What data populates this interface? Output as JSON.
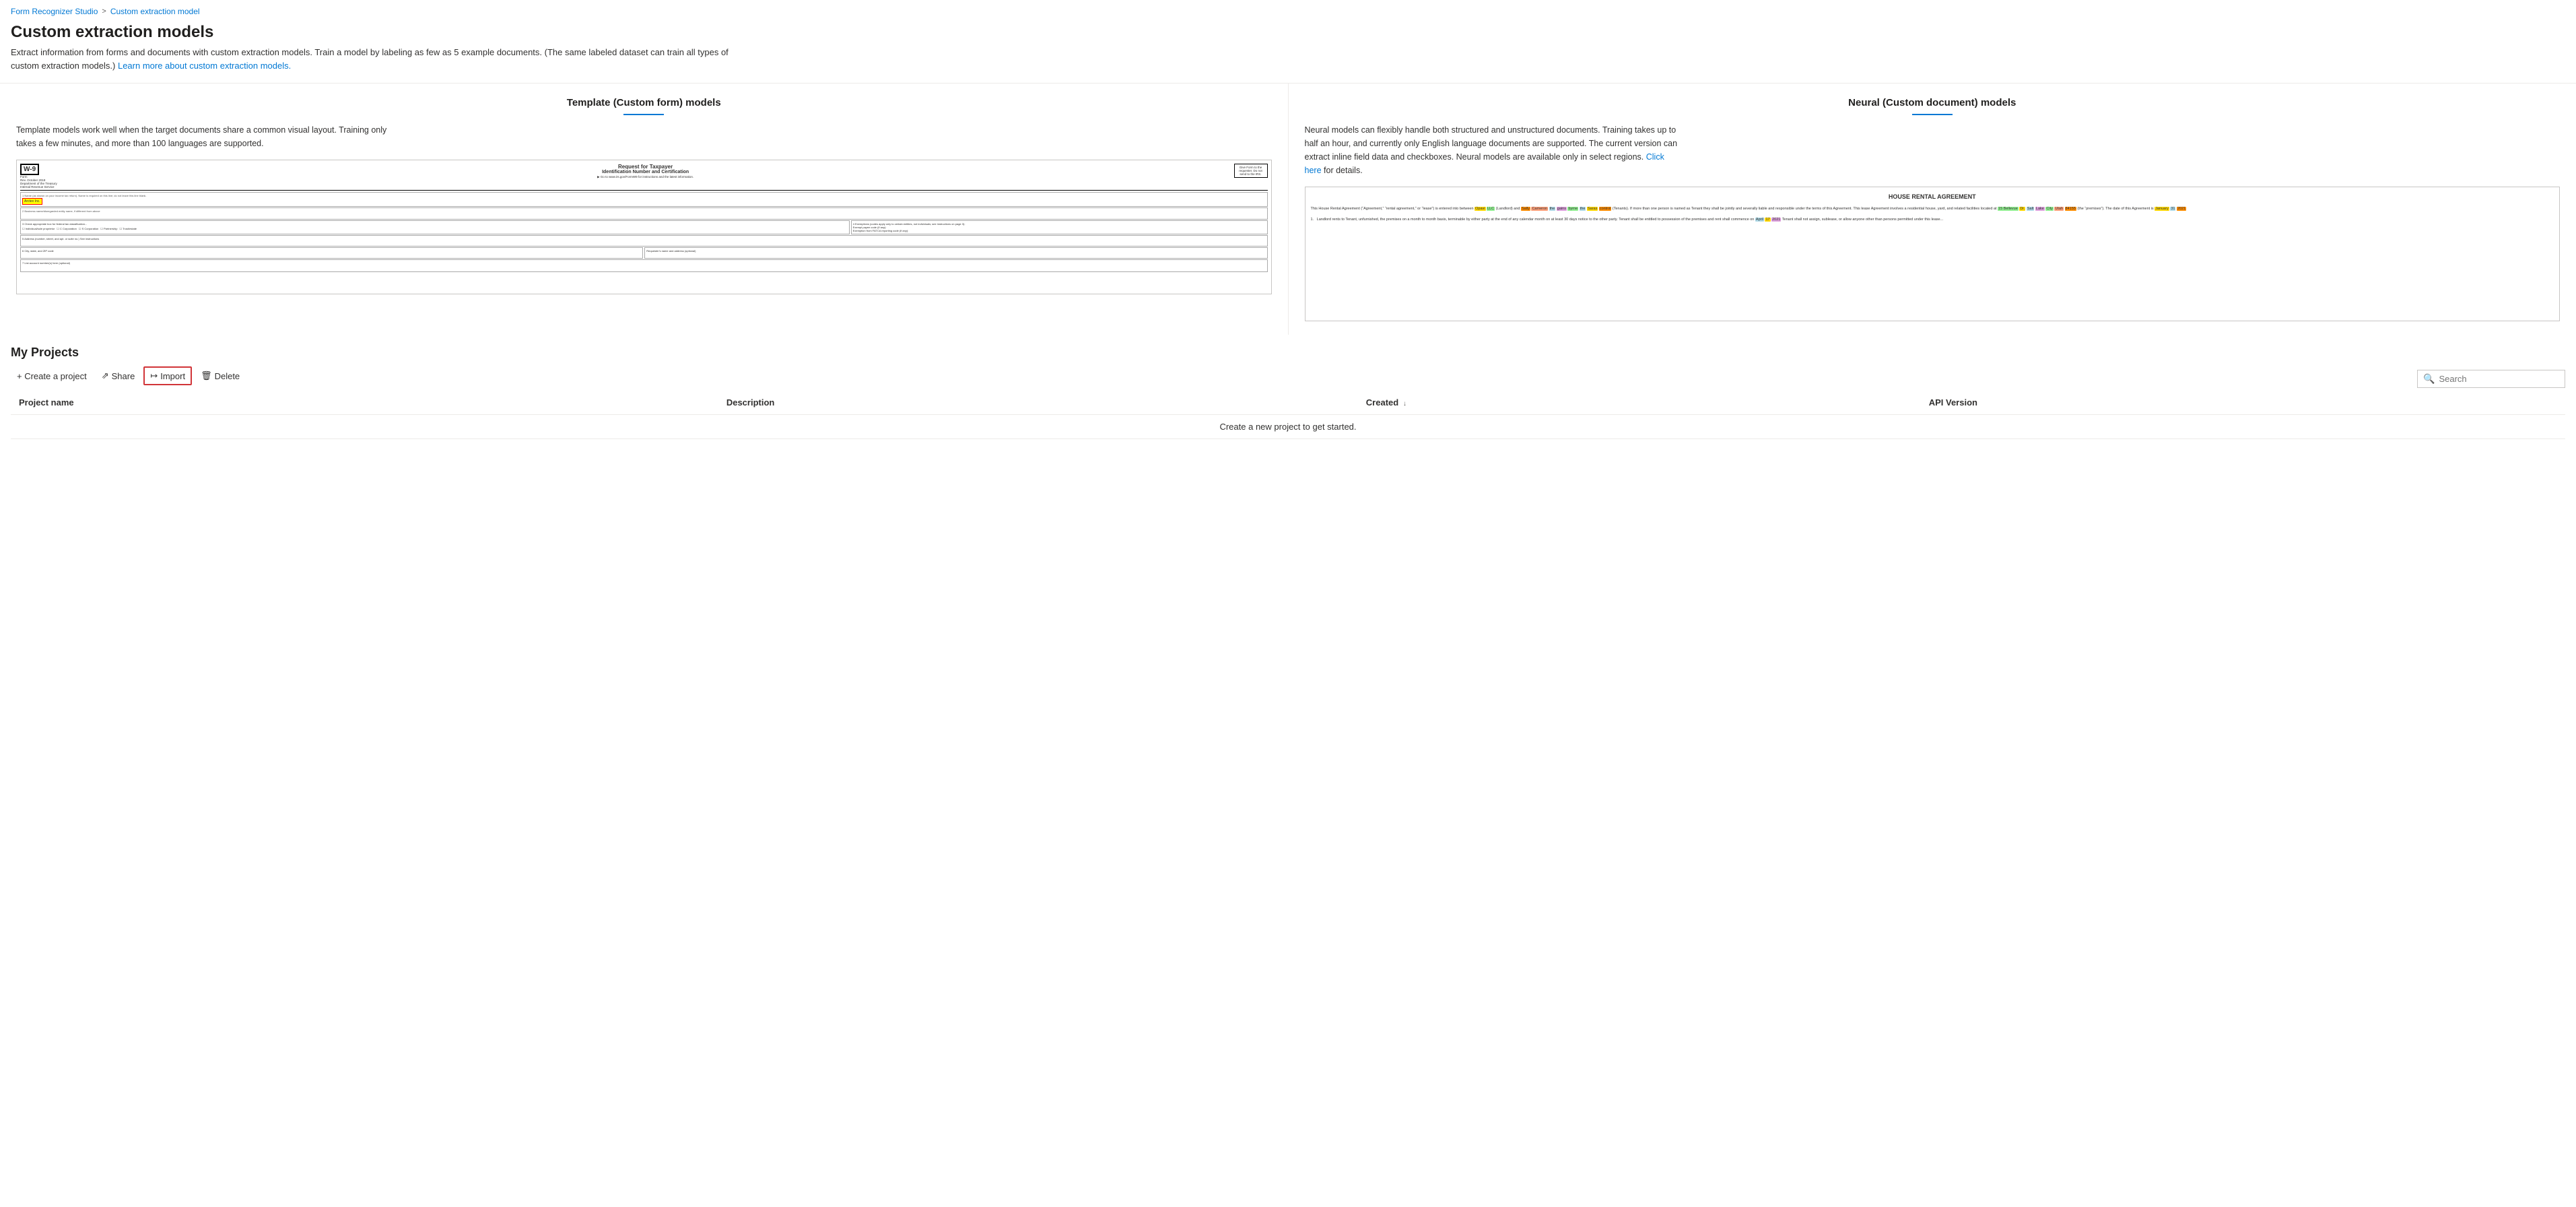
{
  "breadcrumb": {
    "home_label": "Form Recognizer Studio",
    "home_url": "#",
    "separator": ">",
    "current_label": "Custom extraction model"
  },
  "page": {
    "title": "Custom extraction models",
    "subtitle": "Extract information from forms and documents with custom extraction models. Train a model by labeling as few as 5 example documents. (The same labeled dataset can train all types of custom extraction models.)",
    "subtitle_link_text": "Learn more about custom extraction models.",
    "subtitle_link_url": "#"
  },
  "model_cards": [
    {
      "id": "template",
      "title": "Template (Custom form) models",
      "description": "Template models work well when the target documents share a common visual layout. Training only takes a few minutes, and more than 100 languages are supported."
    },
    {
      "id": "neural",
      "title": "Neural (Custom document) models",
      "description": "Neural models can flexibly handle both structured and unstructured documents. Training takes up to half an hour, and currently only English language documents are supported. The current version can extract inline field data and checkboxes. Neural models are available only in select regions.",
      "click_here_text": "Click here",
      "for_details_text": " for details."
    }
  ],
  "projects": {
    "section_title": "My Projects",
    "toolbar": {
      "create_label": "+ Create a project",
      "share_label": "Share",
      "import_label": "Import",
      "delete_label": "Delete"
    },
    "search": {
      "placeholder": "Search"
    },
    "table": {
      "columns": [
        {
          "id": "name",
          "label": "Project name",
          "sortable": false
        },
        {
          "id": "description",
          "label": "Description",
          "sortable": false
        },
        {
          "id": "created",
          "label": "Created",
          "sortable": true,
          "sort_direction": "↓"
        },
        {
          "id": "api_version",
          "label": "API Version",
          "sortable": false
        }
      ],
      "rows": [],
      "empty_state": "Create a new project to get started."
    }
  },
  "w9_form": {
    "form_id": "W-9",
    "subtitle": "Request for Taxpayer\nIdentification Number and Certification",
    "highlighted_name": "Arctex Inc.",
    "give_form": "Give Form to the\nrequester. Do not\nsend to the IRS."
  },
  "rental_agreement": {
    "title": "HOUSE RENTAL AGREEMENT",
    "text_preview": "This House Rental Agreement (\"Agreement,\" \"rental agreement,\" or \"lease\") is entered into between"
  }
}
